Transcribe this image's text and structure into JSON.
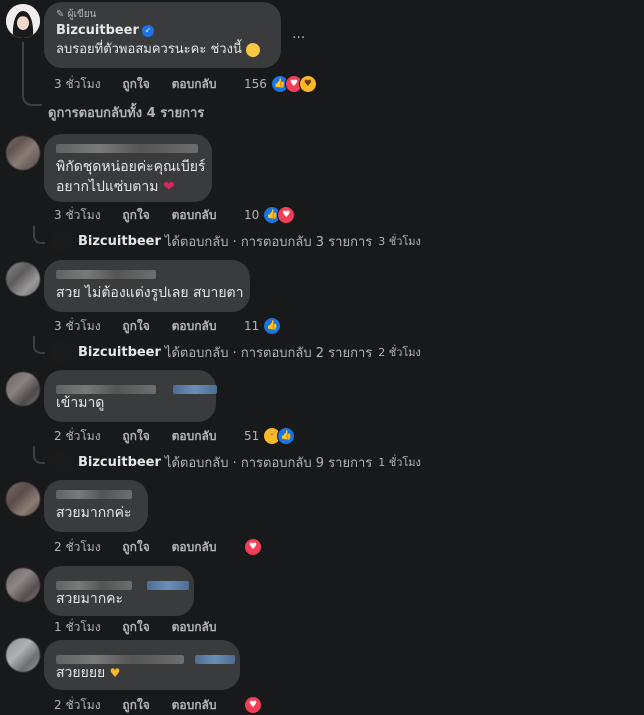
{
  "top_comment": {
    "author_badge": "ผู้เขียน",
    "author": "Bizcuitbeer",
    "text": "ลบรอยที่ตัวพอสมควรนะคะ ช่วงนี้",
    "time": "3 ชั่วโมง",
    "like": "ถูกใจ",
    "reply": "ตอบกลับ",
    "reaction_count": "156",
    "more": "...",
    "view_replies": "ดูการตอบกลับทั้ง 4 รายการ"
  },
  "comments": [
    {
      "text_line1": "พิกัดชุดหน่อยค่ะคุณเบียร์",
      "text_line2": "อยากไปแซ่บตาม",
      "time": "3 ชั่วโมง",
      "like": "ถูกใจ",
      "reply": "ตอบกลับ",
      "reaction_count": "10",
      "replied_by": "Bizcuitbeer",
      "reply_summary": "ได้ตอบกลับ · การตอบกลับ 3 รายการ",
      "reply_time": "3 ชั่วโมง"
    },
    {
      "text_line1": "สวย ไม่ต้องแต่งรูปเลย สบายตา",
      "time": "3 ชั่วโมง",
      "like": "ถูกใจ",
      "reply": "ตอบกลับ",
      "reaction_count": "11",
      "replied_by": "Bizcuitbeer",
      "reply_summary": "ได้ตอบกลับ · การตอบกลับ 2 รายการ",
      "reply_time": "2 ชั่วโมง"
    },
    {
      "text_line1": "เข้ามาดู",
      "time": "2 ชั่วโมง",
      "like": "ถูกใจ",
      "reply": "ตอบกลับ",
      "reaction_count": "51",
      "replied_by": "Bizcuitbeer",
      "reply_summary": "ได้ตอบกลับ · การตอบกลับ 9 รายการ",
      "reply_time": "1 ชั่วโมง"
    },
    {
      "text_line1": "สวยมากกค่ะ",
      "time": "2 ชั่วโมง",
      "like": "ถูกใจ",
      "reply": "ตอบกลับ"
    },
    {
      "text_line1": "สวยมากคะ",
      "time": "1 ชั่วโมง",
      "like": "ถูกใจ",
      "reply": "ตอบกลับ"
    },
    {
      "text_line1": "สวยยยย",
      "time": "2 ชั่วโมง",
      "like": "ถูกใจ",
      "reply": "ตอบกลับ"
    }
  ],
  "colors": {
    "background": "#18191a",
    "bubble": "#3a3b3c",
    "meta_text": "#b0b3b8",
    "like_blue": "#1b74e4",
    "love_red": "#f33e58"
  }
}
